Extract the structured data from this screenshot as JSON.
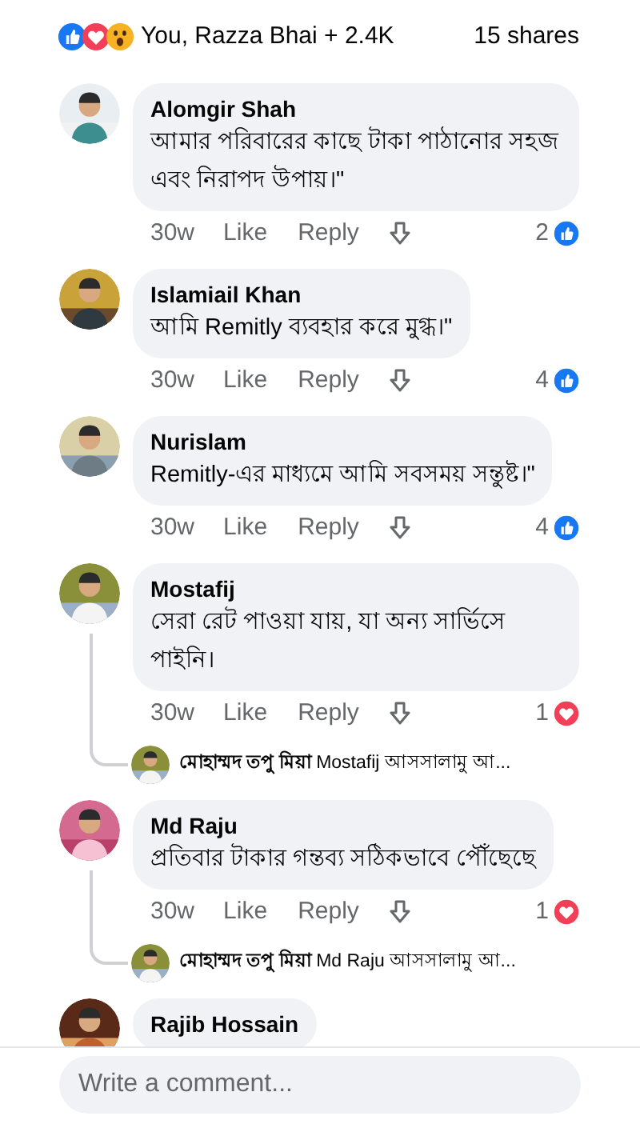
{
  "summary": {
    "reactions_text": "You, Razza Bhai + 2.4K",
    "shares": "15 shares"
  },
  "comments": [
    {
      "name": "Alomgir Shah",
      "text": "আমার পরিবারের কাছে টাকা পাঠানোর সহজ এবং নিরাপদ উপায়।\"",
      "time": "30w",
      "like": "Like",
      "reply": "Reply",
      "count": "2",
      "kind": "like"
    },
    {
      "name": "Islamiail Khan",
      "text": "আমি Remitly ব্যবহার করে মুগ্ধ।\"",
      "time": "30w",
      "like": "Like",
      "reply": "Reply",
      "count": "4",
      "kind": "like"
    },
    {
      "name": "Nurislam",
      "text": "Remitly-এর মাধ্যমে আমি সবসময় সন্তুষ্ট।\"",
      "time": "30w",
      "like": "Like",
      "reply": "Reply",
      "count": "4",
      "kind": "like"
    },
    {
      "name": "Mostafij",
      "text": "সেরা রেট পাওয়া যায়, যা অন্য সার্ভিসে পাইনি।",
      "time": "30w",
      "like": "Like",
      "reply": "Reply",
      "count": "1",
      "kind": "love",
      "reply_preview": "**মোহাম্মদ তপু মিয়া** Mostafij আসসালামু আ..."
    },
    {
      "name": "Md Raju",
      "text": "প্রতিবার টাকার গন্তব্য সঠিকভাবে পৌঁছেছে",
      "time": "30w",
      "like": "Like",
      "reply": "Reply",
      "count": "1",
      "kind": "love",
      "reply_preview": "**মোহাম্মদ তপু মিয়া** Md Raju আসসালামু আ..."
    },
    {
      "name": "Rajib Hossain"
    }
  ],
  "composer": {
    "placeholder": "Write a comment..."
  }
}
